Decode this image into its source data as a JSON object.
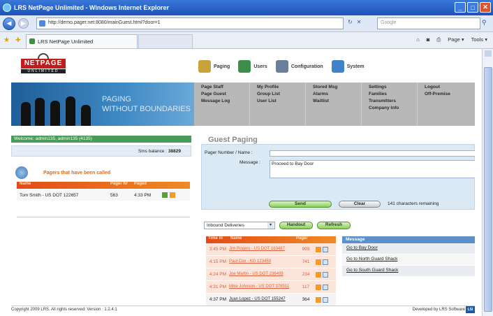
{
  "window": {
    "title": "LRS NetPage Unlimited - Windows Internet Explorer",
    "min": "_",
    "max": "□",
    "close": "✕"
  },
  "address": {
    "url": "http://demo.pager.net:8080/mainGuest.html?door=1",
    "search_placeholder": "Google"
  },
  "tab": {
    "label": "LRS NetPage Unlimited"
  },
  "ie_tools": {
    "page": "Page ▾",
    "tools": "Tools ▾"
  },
  "logo": {
    "main": "NETPAGE",
    "sub": "UNLIMITED"
  },
  "topnav": [
    {
      "label": "Paging",
      "icon": "paging-icon",
      "color": "#c8a23a"
    },
    {
      "label": "Users",
      "icon": "users-icon",
      "color": "#3b8f4a"
    },
    {
      "label": "Configuration",
      "icon": "configuration-icon",
      "color": "#6b7f9a"
    },
    {
      "label": "System",
      "icon": "system-icon",
      "color": "#3f82c9"
    }
  ],
  "banner": {
    "line1": "PAGING",
    "line2": "WITHOUT BOUNDARIES"
  },
  "menu": [
    [
      "Page Staff",
      "Page Guest",
      "Message Log"
    ],
    [
      "My Profile",
      "Group List",
      "User List"
    ],
    [
      "Stored Msg",
      "Alarms",
      "Waitlist"
    ],
    [
      "Settings",
      "Families",
      "Transmitters",
      "Company Info"
    ],
    [
      "Logout",
      "Off-Premise"
    ]
  ],
  "welcome": "Welcome: admin135, admin135 (4135)",
  "balance": {
    "label": "Sms balance :",
    "value": "38829"
  },
  "pagers_box": {
    "title": "Pagers that have been called",
    "headers": [
      "Name",
      "Pager Nr",
      "Paged"
    ],
    "row": {
      "name": "Tom Smith - US DOT 122657",
      "pager": "563",
      "time": "4:33 PM"
    }
  },
  "guest": {
    "title": "Guest Paging",
    "pager_label": "Pager Number / Name :",
    "message_label": "Message :",
    "message_value": "Proceed to Bay Door",
    "send": "Send",
    "clear": "Clear",
    "remaining": "141 characters remaining"
  },
  "deliveries": {
    "select": "Inbound Deliveries",
    "handout": "Handout",
    "refresh": "Refresh",
    "headers": [
      "Time In",
      "Name",
      "Pager"
    ],
    "rows": [
      {
        "time": "3:45 PM",
        "name": "Jim Rogers - US DOT 163487",
        "pager": "999"
      },
      {
        "time": "4:15 PM",
        "name": "Paul Cox - KG 123459",
        "pager": "741"
      },
      {
        "time": "4:24 PM",
        "name": "Joe Martin - US DOT 236409",
        "pager": "234"
      },
      {
        "time": "4:31 PM",
        "name": "Mike Johnson - US DOT 378511",
        "pager": "117"
      },
      {
        "time": "4:37 PM",
        "name": "Juan Lopez - US DOT 155247",
        "pager": "364"
      }
    ]
  },
  "messages": {
    "header": "Message",
    "items": [
      "Go to Bay Door",
      "Go to North Guard Shack",
      "Go to South Guard Shack"
    ]
  },
  "footer": {
    "left": "Copyright 2009 LRS. All rights reserved. Version : 1.2.4.1",
    "right": "Developed by LRS Software",
    "badge": "LSI"
  }
}
